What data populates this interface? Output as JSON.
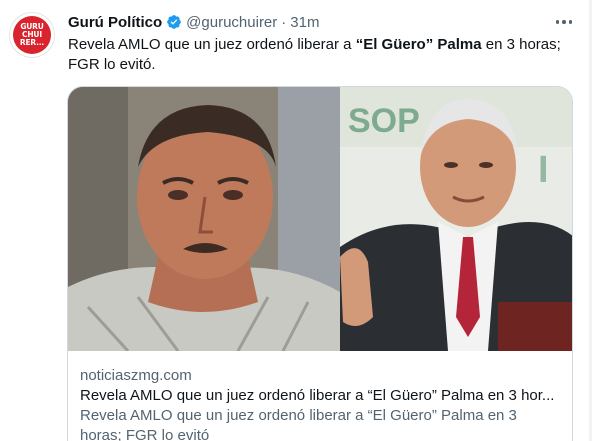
{
  "author": {
    "avatar_text": "GURU CHUI RER...",
    "avatar_color": "#d9232d",
    "display_name": "Gurú Político",
    "verified_icon": "verified-badge-icon",
    "handle": "@guruchuirer",
    "separator": "·",
    "time": "31m"
  },
  "tweet": {
    "text_part1": "Revela AMLO que un juez ordenó liberar a ",
    "text_bold1": "“El Güero”",
    "text_part2": " ",
    "text_bold2": "Palma",
    "text_part3": " en 3 horas; FGR lo evitó."
  },
  "card": {
    "domain": "noticiaszmg.com",
    "title": "Revela AMLO que un juez ordenó liberar a “El Güero” Palma en 3 hor...",
    "description": "Revela AMLO que un juez ordenó liberar a “El Güero” Palma en 3 horas; FGR lo evitó"
  },
  "colors": {
    "text_primary": "#0f1419",
    "text_secondary": "#536471",
    "verified_blue": "#1d9bf0",
    "card_border": "#cfd9de"
  }
}
